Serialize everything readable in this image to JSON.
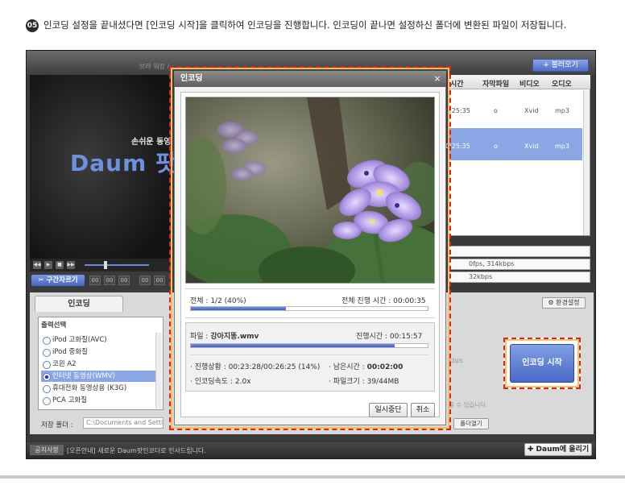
{
  "instruction": {
    "step": "05",
    "text": "인코딩 설정을 끝내셨다면 [인코딩 시작]을 클릭하여 인코딩을 진행합니다. 인코딩이 끝나면 설정하신 폴더에 변환된 파일이 저장됩니다."
  },
  "app": {
    "menu_text": "브라 워킹 /",
    "load_button": "+ 불러오기",
    "tagline": "손쉬운 동영",
    "brand": "Daum 팟인",
    "transport_buttons": [
      "◀◀",
      "▶",
      "■",
      "▶▶"
    ],
    "cut_button": "✂ 구간자르기",
    "time_boxes": [
      "00",
      "00",
      "00",
      "00",
      "00"
    ],
    "list_headers": [
      "시간",
      "자막파일",
      "비디오",
      "오디오"
    ],
    "list_rows": [
      {
        "time": "0:25:35",
        "subtitle": "o",
        "video": "Xvid",
        "audio": "mp3",
        "selected": false
      },
      {
        "time": "0:25:35",
        "subtitle": "o",
        "video": "Xvid",
        "audio": "mp3",
        "selected": true
      }
    ],
    "info_lines": [
      "",
      "0fps, 314kbps",
      "32kbps"
    ],
    "encoding_tab": "인코딩",
    "settings_button": "⚙ 환경설정",
    "output_title": "출력선택",
    "output_options": [
      {
        "label": "iPod 고화질(AVC)",
        "selected": false
      },
      {
        "label": "iPod 중화질",
        "selected": false
      },
      {
        "label": "코윈 A2",
        "selected": false
      },
      {
        "label": "인터넷 동영상(WMV)",
        "selected": true
      },
      {
        "label": "휴대전화 동영상용 (K3G)",
        "selected": false
      },
      {
        "label": "PCA 고화질",
        "selected": false
      }
    ],
    "folder_label": "저장 폴더 :",
    "folder_value": "C:\\Documents and Settings",
    "right_info_1": "kbps",
    "right_info_2": "출 수 있습니다.",
    "open_folder_button": "폴더열기",
    "start_button": "인코딩 시작",
    "notice_badge": "공지사항",
    "notice_text": "[오픈안내] 새로운 Daum팟인코더로 인사드립니다.",
    "upload_button": "✚ Daum에 올리기"
  },
  "dialog": {
    "title": "인코딩",
    "close": "×",
    "overall_label": "전체 : 1/2 (40%)",
    "overall_progress": 0.4,
    "overall_time_label": "전체 진행 시간 : 00:00:35",
    "file_label": "파일 : ",
    "file_name": "강아지똥.wmv",
    "file_time_label": "진행시간 : 00:15:57",
    "file_progress": 0.86,
    "status_progress": "· 진행상황 : 00:23:28/00:26:25 (14%)",
    "remaining_label": "· 남은시간 : ",
    "remaining_value": "00:02:00",
    "speed": "· 인코딩속도 : 2.0x",
    "file_size": "· 파일크기 : 39/44MB",
    "pause_button": "일시중단",
    "cancel_button": "취소"
  }
}
